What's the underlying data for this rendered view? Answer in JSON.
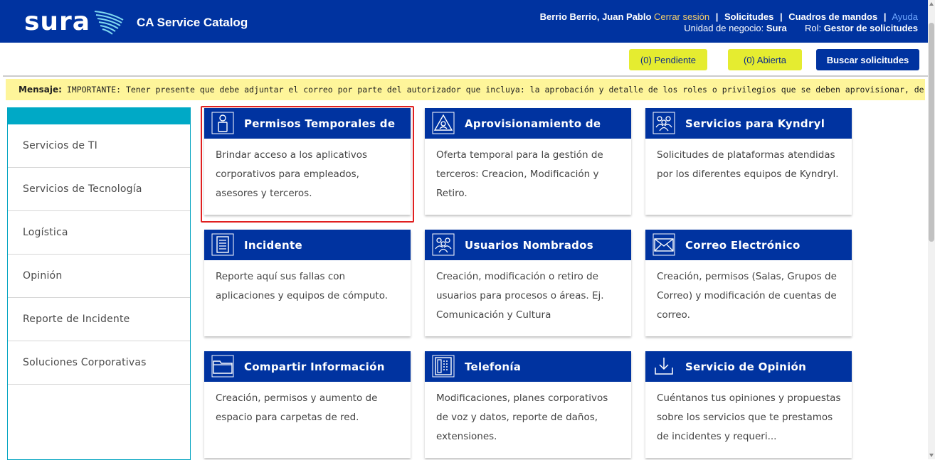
{
  "header": {
    "logo_text": "sura",
    "app_title": "CA Service Catalog",
    "user_name": "Berrio Berrio, Juan Pablo",
    "logout": "Cerrar sesión",
    "links": [
      "Solicitudes",
      "Cuadros de mandos"
    ],
    "help": "Ayuda",
    "business_unit_label": "Unidad de negocio:",
    "business_unit": "Sura",
    "role_label": "Rol:",
    "role": "Gestor de solicitudes"
  },
  "toolbar": {
    "pending": "(0) Pendiente",
    "open": "(0) Abierta",
    "search": "Buscar solicitudes"
  },
  "message": {
    "label": "Mensaje:",
    "text": "IMPORTANTE: Tener presente que debe adjuntar el correo por parte del autorizador que incluya: la aprobación y detalle de los roles o privilegios que se deben aprovisionar, de lo contrario el"
  },
  "sidebar": {
    "items": [
      {
        "label": "Servicios de TI"
      },
      {
        "label": "Servicios de Tecnología"
      },
      {
        "label": "Logística"
      },
      {
        "label": "Opinión"
      },
      {
        "label": "Reporte de Incidente"
      },
      {
        "label": "Soluciones Corporativas"
      }
    ]
  },
  "cards": [
    {
      "title": "Permisos Temporales de",
      "icon": "person-icon",
      "desc": "Brindar acceso a los aplicativos corporativos para empleados, asesores y terceros."
    },
    {
      "title": "Aprovisionamiento de",
      "icon": "user-warning-icon",
      "desc": "Oferta temporal para la gestión de terceros: Creacion, Modificación y Retiro."
    },
    {
      "title": "Servicios para Kyndryl",
      "icon": "group-icon",
      "desc": "Solicitudes de plataformas atendidas por los diferentes equipos de Kyndryl."
    },
    {
      "title": "Incidente",
      "icon": "document-icon",
      "desc": "Reporte aquí sus fallas con aplicaciones y equipos de cómputo."
    },
    {
      "title": "Usuarios Nombrados",
      "icon": "group-icon",
      "desc": "Creación, modificación o retiro de usuarios para procesos o áreas. Ej. Comunicación y Cultura"
    },
    {
      "title": "Correo Electrónico",
      "icon": "envelope-icon",
      "desc": "Creación, permisos (Salas, Grupos de Correo) y modificación de cuentas de correo."
    },
    {
      "title": "Compartir Información",
      "icon": "folder-icon",
      "desc": "Creación, permisos y aumento de espacio para carpetas de red."
    },
    {
      "title": "Telefonía",
      "icon": "phone-icon",
      "desc": "Modificaciones, planes corporativos de voz y datos, reporte de daños, extensiones."
    },
    {
      "title": "Servicio de Opinión",
      "icon": "download-tray-icon",
      "desc": "Cuéntanos tus opiniones y propuestas sobre los servicios que te prestamos de incidentes y requeri..."
    }
  ],
  "colors": {
    "brand_blue": "#0033a0",
    "accent_cyan": "#00a9c6",
    "button_yellow": "#e5ec30",
    "message_yellow": "#fef59a",
    "selection_red": "#e02020"
  }
}
